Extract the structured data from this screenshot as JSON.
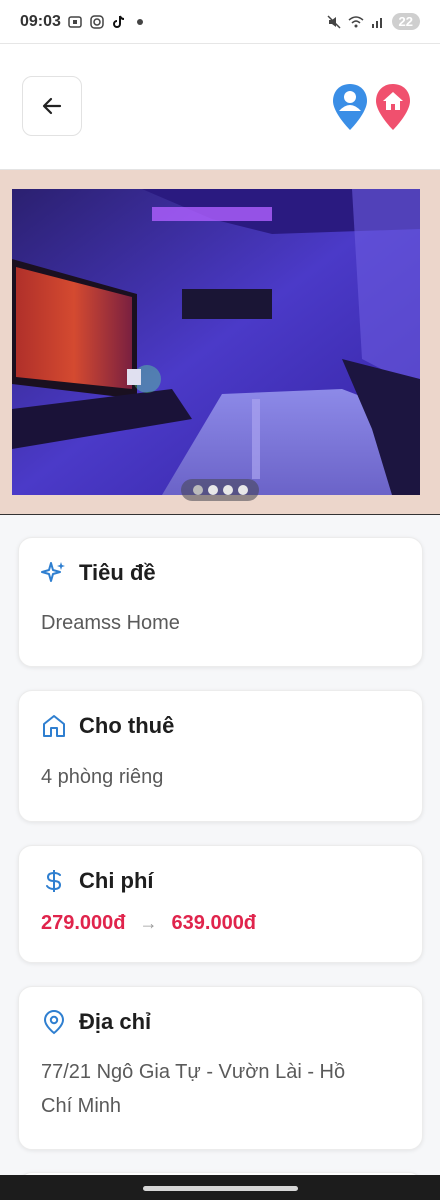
{
  "status_bar": {
    "time": "09:03",
    "battery": "22"
  },
  "colors": {
    "accent_blue": "#2f7fd0",
    "accent_red": "#e0244c",
    "pin_blue": "#3a8ee6",
    "pin_red": "#f0506e"
  },
  "gallery": {
    "image_count": 4,
    "active_index": 0
  },
  "cards": {
    "title": {
      "label": "Tiêu đề",
      "value": "Dreamss Home",
      "icon": "sparkles-icon"
    },
    "rent": {
      "label": "Cho thuê",
      "value": "4 phòng riêng",
      "icon": "home-icon"
    },
    "cost": {
      "label": "Chi phí",
      "min": "279.000đ",
      "arrow": "→",
      "max": "639.000đ",
      "icon": "dollar-icon"
    },
    "address": {
      "label": "Địa chỉ",
      "line1": "77/21 Ngô Gia Tự - Vườn Lài - Hồ",
      "line2": "Chí Minh",
      "icon": "map-pin-icon"
    }
  }
}
